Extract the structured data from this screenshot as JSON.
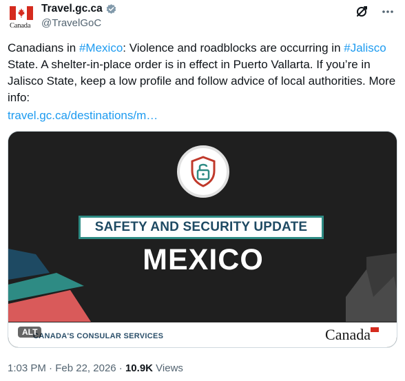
{
  "account": {
    "display_name": "Travel.gc.ca",
    "handle": "@TravelGoC",
    "avatar_wordmark": "Canada",
    "verified_icon": "verified-badge-icon"
  },
  "actions": {
    "grok_icon": "grok-icon",
    "more_icon": "more-options-icon"
  },
  "tweet": {
    "text_1": "Canadians in ",
    "tag_1": "#Mexico",
    "text_2": ": Violence and roadblocks are occurring in ",
    "tag_2": "#Jalisco",
    "text_3": " State. A shelter-in-place order is in effect in Puerto Vallarta. If you’re in Jalisco State, keep a low profile and follow advice of local authorities. More info:",
    "link": "travel.gc.ca/destinations/m…"
  },
  "media": {
    "banner": "SAFETY AND SECURITY UPDATE",
    "country": "MEXICO",
    "footer_left": "CANADA'S CONSULAR SERVICES",
    "footer_right": "Canada",
    "alt": "ALT",
    "colors": {
      "teal": "#2e8b84",
      "navy": "#1e4a63",
      "red": "#d95a5a",
      "bg": "#1f1f1f"
    }
  },
  "meta": {
    "time": "1:03 PM",
    "separator": " · ",
    "date": "Feb 22, 2026",
    "views_count": "10.9K",
    "views_label": " Views"
  }
}
